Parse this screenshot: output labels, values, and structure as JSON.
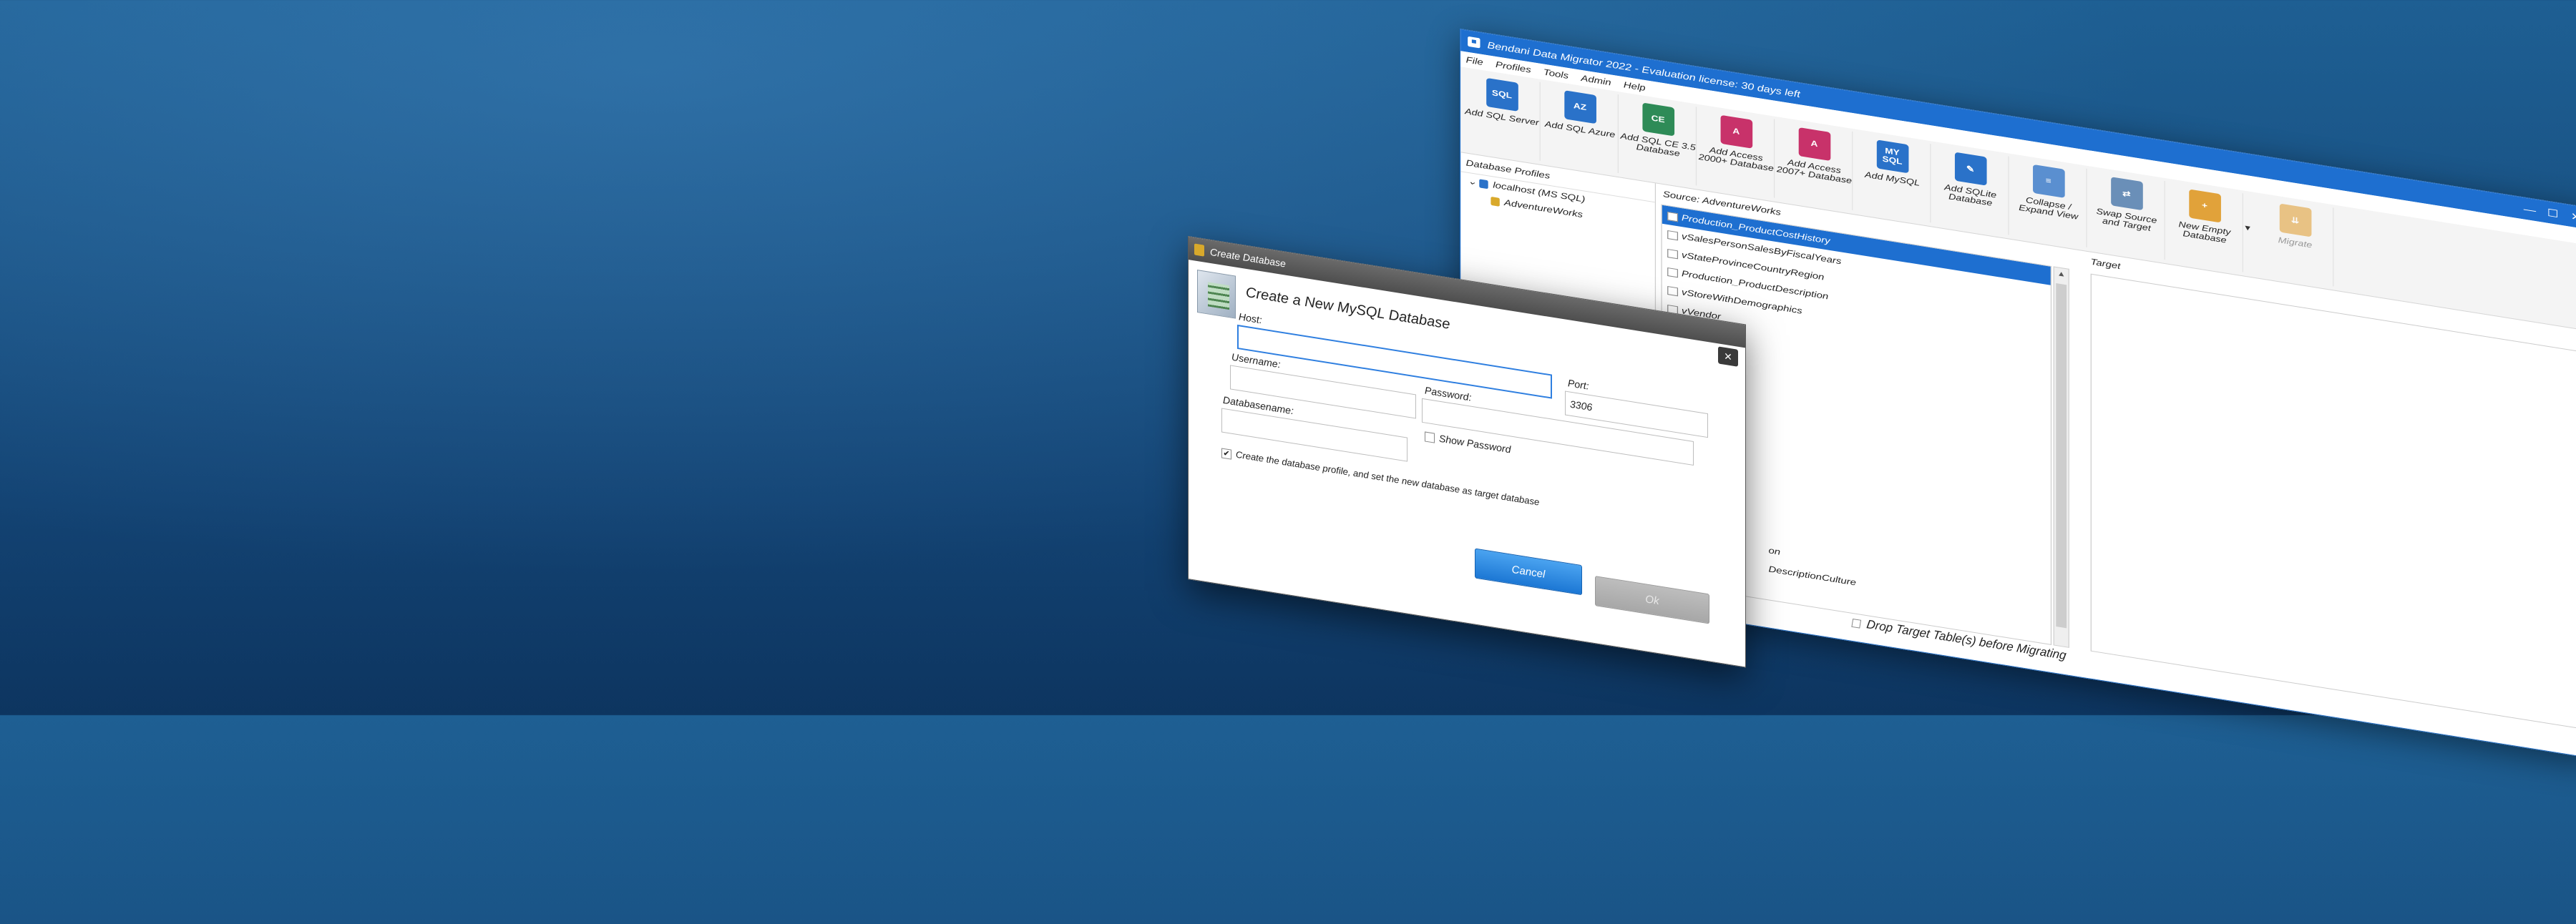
{
  "app": {
    "title": "Bendani Data Migrator 2022 - Evaluation license: 30 days left",
    "window_controls": [
      "—",
      "☐",
      "✕"
    ]
  },
  "menu": [
    "File",
    "Profiles",
    "Tools",
    "Admin",
    "Help"
  ],
  "ribbon": [
    {
      "label": "Add SQL Server",
      "icon": "sql-server-icon",
      "glyph": "SQL",
      "color": "#2a72c9"
    },
    {
      "label": "Add SQL Azure",
      "icon": "sql-azure-icon",
      "glyph": "AZ",
      "color": "#2a72c9"
    },
    {
      "label": "Add SQL CE 3.5 Database",
      "icon": "sql-ce-icon",
      "glyph": "CE",
      "color": "#2e8b57"
    },
    {
      "label": "Add Access 2000+ Database",
      "icon": "access-icon",
      "glyph": "A",
      "color": "#c8326a"
    },
    {
      "label": "Add Access 2007+ Database",
      "icon": "access-2007-icon",
      "glyph": "A",
      "color": "#c8326a"
    },
    {
      "label": "Add MySQL",
      "icon": "mysql-icon",
      "glyph": "MY SQL",
      "color": "#2a72c9"
    },
    {
      "label": "Add SQLite Database",
      "icon": "sqlite-icon",
      "glyph": "✎",
      "color": "#2a72c9"
    },
    {
      "label": "Collapse / Expand View",
      "icon": "collapse-expand-icon",
      "glyph": "≡",
      "color": "#5a8fd0"
    },
    {
      "label": "Swap Source and Target",
      "icon": "swap-icon",
      "glyph": "⇄",
      "color": "#6a8fb8"
    },
    {
      "label": "New Empty Database",
      "icon": "new-database-icon",
      "glyph": "+",
      "color": "#e1a23a"
    },
    {
      "label": "Migrate",
      "icon": "migrate-icon",
      "glyph": "⇊",
      "color": "#e1a23a",
      "disabled": true
    }
  ],
  "profiles": {
    "header": "Database Profiles",
    "server": "localhost (MS SQL)",
    "database": "AdventureWorks"
  },
  "source": {
    "header": "Source: AdventureWorks",
    "tables": [
      "Production_ProductCostHistory",
      "vSalesPersonSalesByFiscalYears",
      "vStateProvinceCountryRegion",
      "Production_ProductDescription",
      "vStoreWithDemographics",
      "vVendor"
    ],
    "partial_rows": [
      "on",
      "DescriptionCulture"
    ]
  },
  "target": {
    "header": "Target",
    "drop_label": "Drop Target Table(s) before Migrating"
  },
  "dialog": {
    "title": "Create Database",
    "heading": "Create a New MySQL Database",
    "close": "✕",
    "host_label": "Host:",
    "host_value": "",
    "port_label": "Port:",
    "port_value": "3306",
    "username_label": "Username:",
    "password_label": "Password:",
    "show_password": "Show Password",
    "dbname_label": "Databasename:",
    "create_profile": "Create the database profile, and set the new database as target database",
    "cancel": "Cancel",
    "ok": "Ok"
  }
}
